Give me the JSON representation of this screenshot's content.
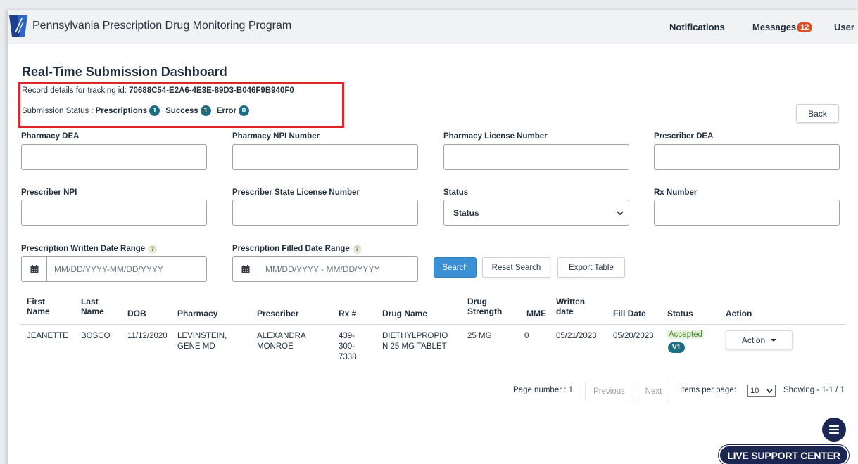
{
  "header": {
    "app_title": "Pennsylvania Prescription Drug Monitoring Program",
    "notifications_label": "Notifications",
    "messages_label": "Messages",
    "messages_count": "12",
    "user_label": "User"
  },
  "dashboard": {
    "title": "Real-Time Submission Dashboard",
    "tracking_prefix": "Record details for tracking id: ",
    "tracking_id": "70688C54-E2A6-4E3E-89D3-B046F9B940F0",
    "submission_status_label": "Submission Status :",
    "counts": [
      {
        "label": "Prescriptions",
        "value": "1"
      },
      {
        "label": "Success",
        "value": "1"
      },
      {
        "label": "Error",
        "value": "0"
      }
    ],
    "back_label": "Back"
  },
  "filters": {
    "pharmacy_dea": "Pharmacy DEA",
    "pharmacy_npi": "Pharmacy NPI Number",
    "pharmacy_license": "Pharmacy License Number",
    "prescriber_dea": "Prescriber DEA",
    "prescriber_npi": "Prescriber NPI",
    "prescriber_state_license": "Prescriber State License Number",
    "status_label": "Status",
    "status_selected": "Status",
    "rx_number": "Rx Number",
    "written_range_label": "Prescription Written Date Range",
    "written_range_placeholder": "MM/DD/YYYY-MM/DD/YYYY",
    "filled_range_label": "Prescription Filled Date Range",
    "filled_range_placeholder": "MM/DD/YYYY - MM/DD/YYYY",
    "help_glyph": "?",
    "search_label": "Search",
    "reset_label": "Reset Search",
    "export_label": "Export Table"
  },
  "table": {
    "headers": {
      "first_name_1": "First",
      "first_name_2": "Name",
      "last_name_1": "Last",
      "last_name_2": "Name",
      "dob": "DOB",
      "pharmacy": "Pharmacy",
      "prescriber": "Prescriber",
      "rx": "Rx #",
      "drug_name": "Drug Name",
      "drug_strength_1": "Drug",
      "drug_strength_2": "Strength",
      "mme": "MME",
      "written_date_1": "Written",
      "written_date_2": "date",
      "fill_date": "Fill Date",
      "status": "Status",
      "action": "Action"
    },
    "rows": [
      {
        "first_name": "JEANETTE",
        "last_name": "BOSCO",
        "dob": "11/12/2020",
        "pharmacy_1": "LEVINSTEIN,",
        "pharmacy_2": "GENE MD",
        "prescriber_1": "ALEXANDRA",
        "prescriber_2": "MONROE",
        "rx_1": "439-",
        "rx_2": "300-",
        "rx_3": "7338",
        "drug_1": "DIETHYLPROPIO",
        "drug_2": "N 25 MG TABLET",
        "strength": "25 MG",
        "mme": "0",
        "written_date": "05/21/2023",
        "fill_date": "05/20/2023",
        "status": "Accepted",
        "version": "V1",
        "action_label": "Action"
      }
    ]
  },
  "pagination": {
    "page_number": "Page number : 1",
    "previous_label": "Previous",
    "next_label": "Next",
    "items_per_page_label": "Items per page:",
    "items_per_page_value": "10",
    "showing": "Showing - 1-1 / 1"
  },
  "support": {
    "live_support_label": "LIVE SUPPORT CENTER"
  },
  "colors": {
    "brand_navy": "#1c2653",
    "badge_teal": "#1b6f80",
    "search_blue": "#3a8fd5",
    "highlight_red": "#e0262b",
    "messages_badge": "#d9502a",
    "accepted_green": "#4d8a2f"
  }
}
